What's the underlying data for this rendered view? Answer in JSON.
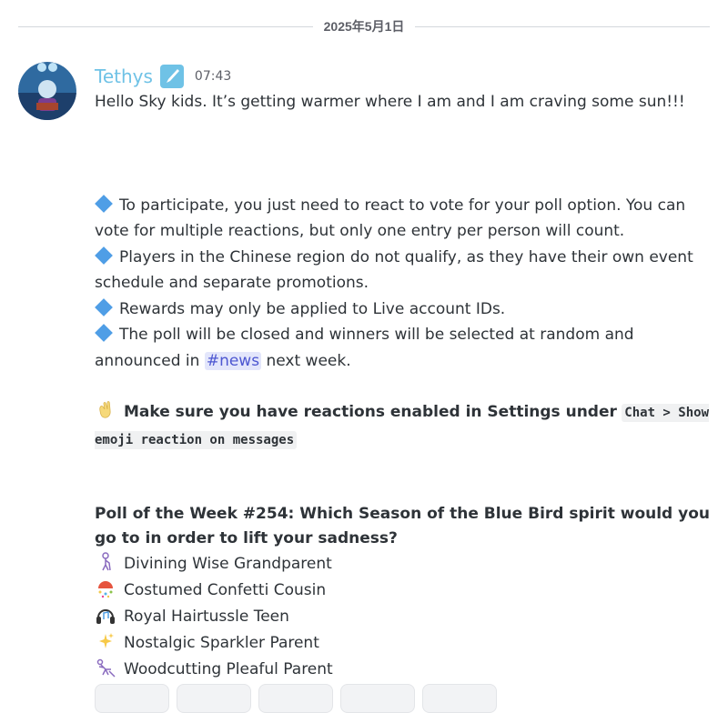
{
  "date_divider": "2025年5月1日",
  "message": {
    "author": "Tethys",
    "timestamp": "07:43",
    "greeting": "Hello Sky kids. It’s getting warmer where I am and I am craving some sun!!!",
    "rules": [
      "To participate, you just need to react to vote for your poll option. You can vote for multiple reactions, but only one entry per person will count.",
      "Players in the Chinese region do not qualify, as they have their own event schedule and separate promotions.",
      "Rewards may only be applied to Live account IDs."
    ],
    "closing_rule_pre": "The poll will be closed and winners will be selected at random and announced in",
    "channel_mention": "#news",
    "closing_rule_post": "next week.",
    "reminder_text": "Make sure you have reactions enabled in Settings under",
    "reminder_code": "Chat > Show emoji reaction on messages",
    "poll_title": "Poll of the Week #254: Which Season of the Blue Bird spirit would you go to in order to lift your sadness?",
    "options": [
      {
        "icon": "old-person-icon",
        "label": "Divining Wise Grandparent"
      },
      {
        "icon": "confetti-icon",
        "label": "Costumed Confetti Cousin"
      },
      {
        "icon": "headphones-icon",
        "label": "Royal Hairtussle Teen"
      },
      {
        "icon": "sparkles-icon",
        "label": "Nostalgic Sparkler Parent"
      },
      {
        "icon": "woodcutting-icon",
        "label": "Woodcutting Pleaful Parent"
      }
    ]
  },
  "colors": {
    "username": "#6fc2e6",
    "mention_bg": "#e3e6fb",
    "mention_text": "#4d57d1",
    "diamond": "#4f9ee6"
  }
}
